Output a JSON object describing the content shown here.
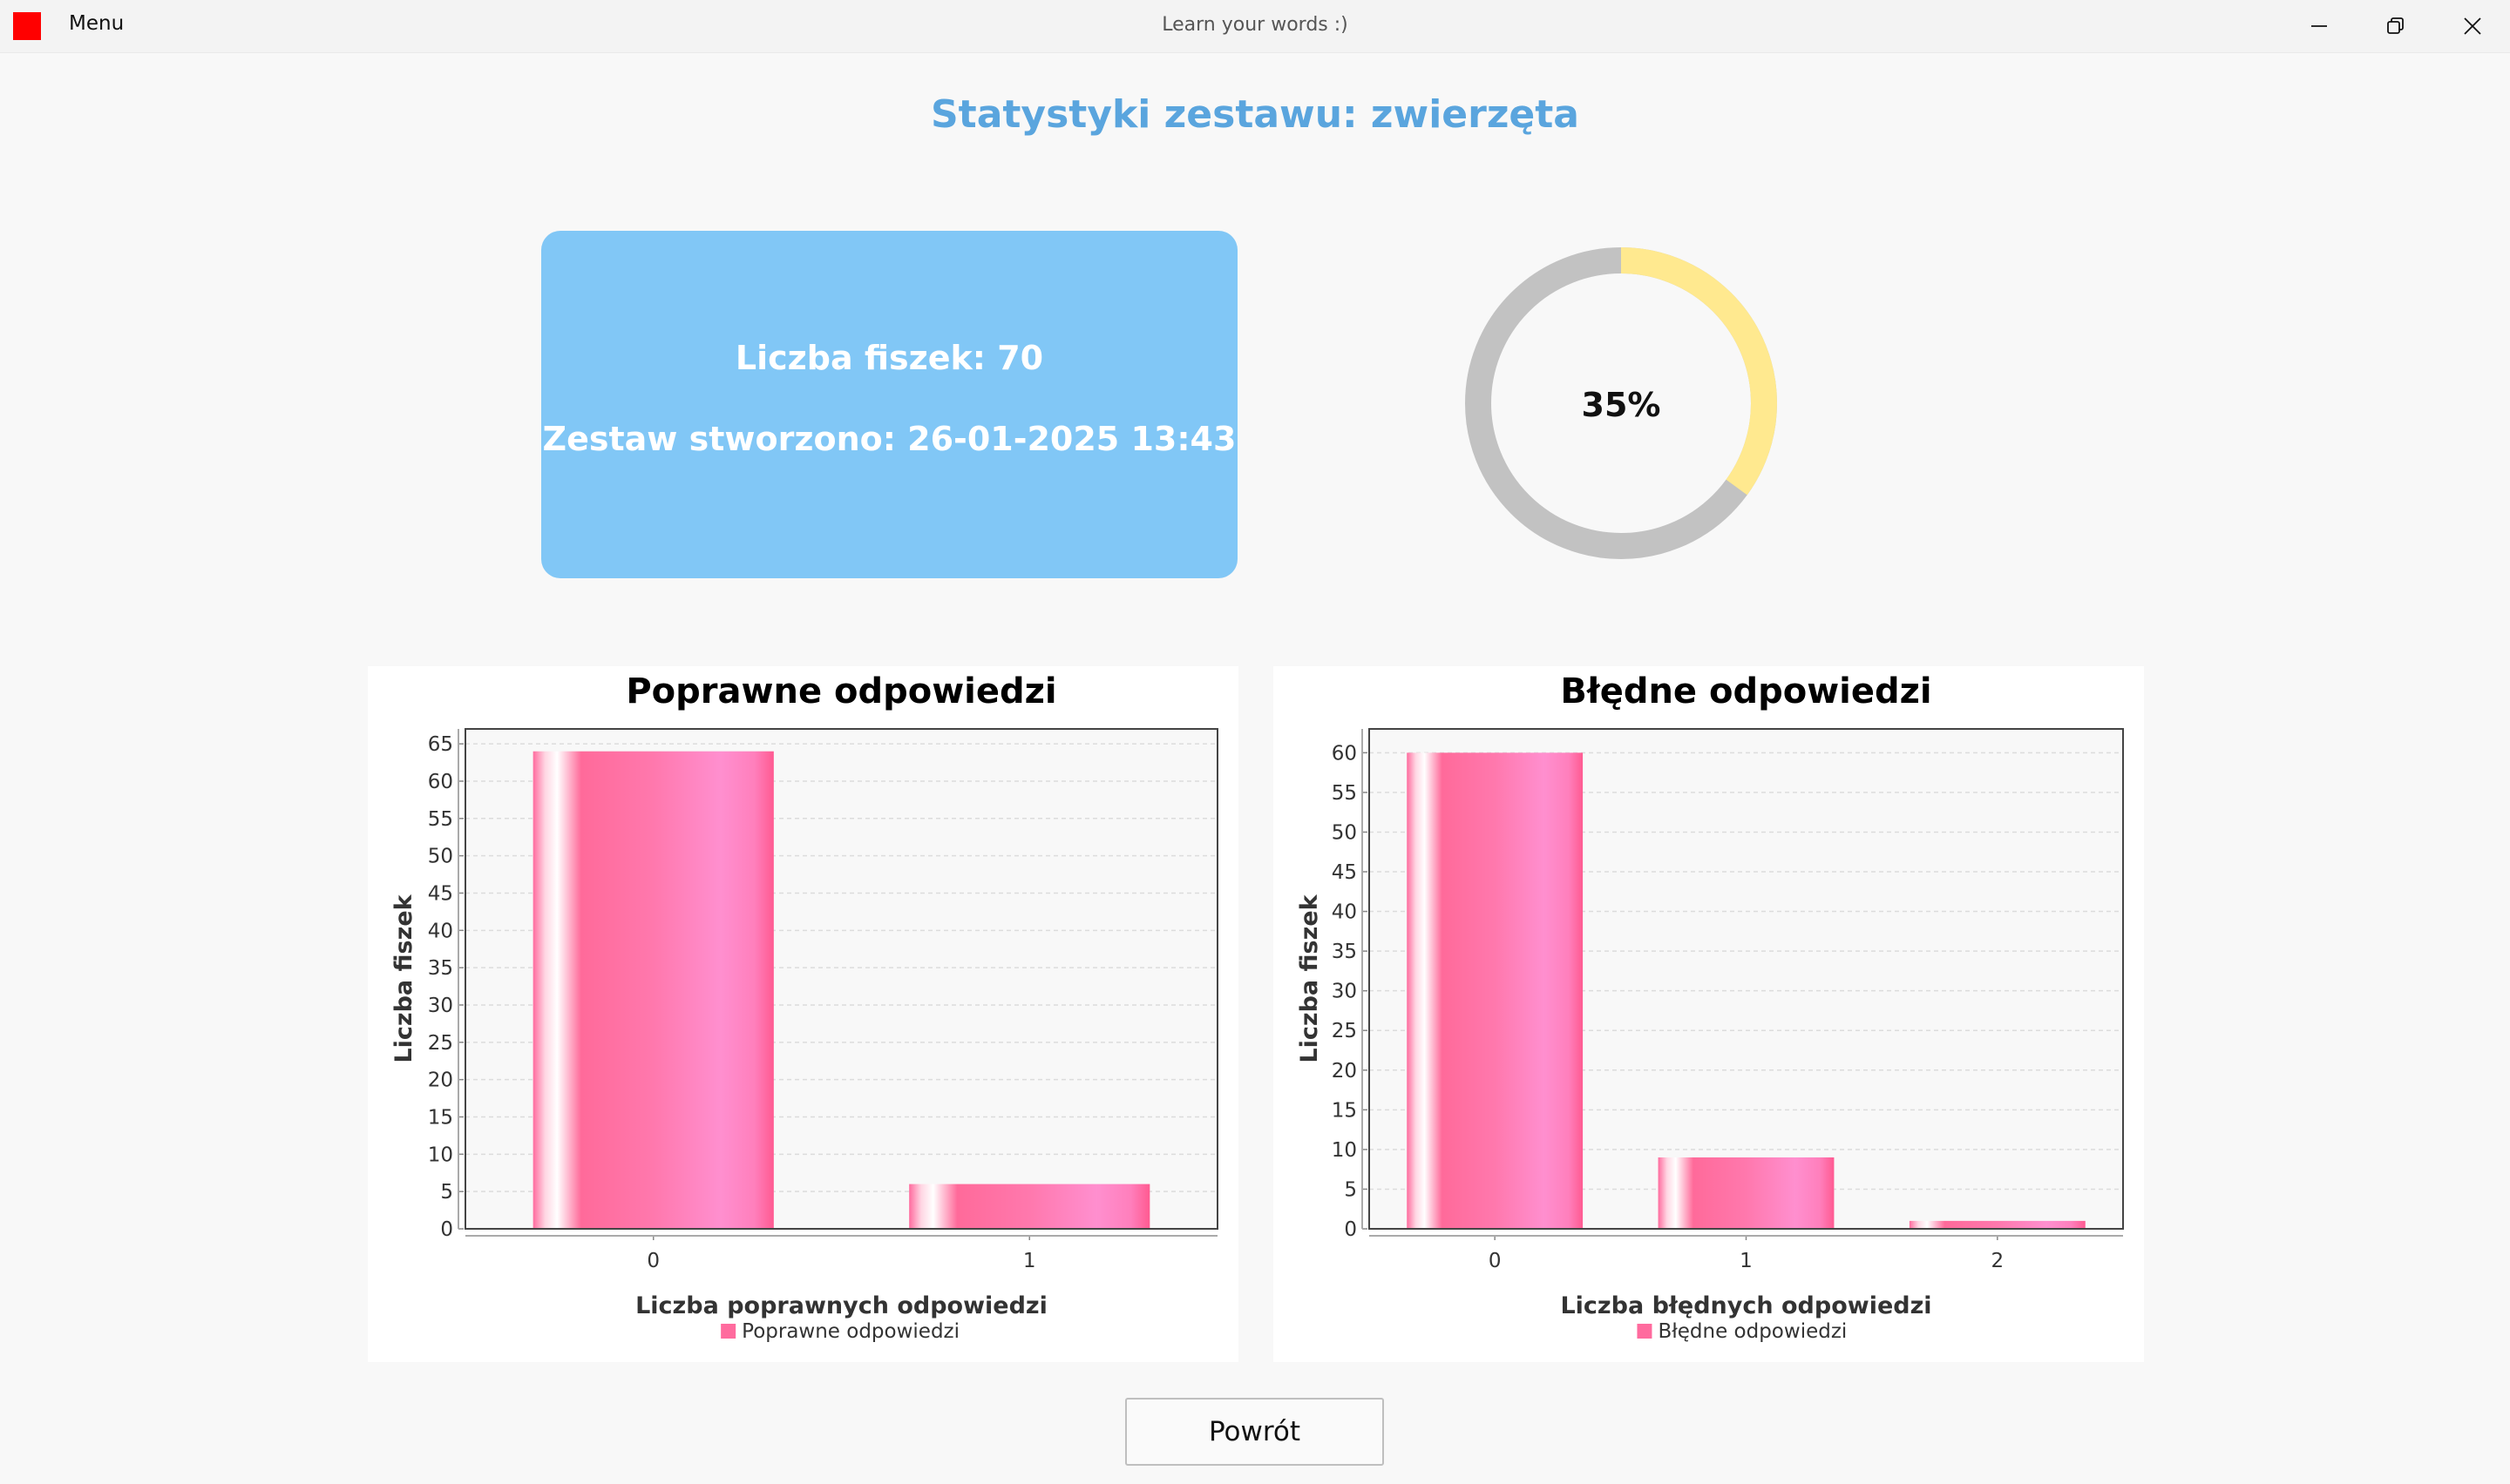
{
  "window": {
    "menu_label": "Menu",
    "title": "Learn your words :)",
    "icons": [
      "app-icon",
      "minimize-icon",
      "restore-icon",
      "close-icon"
    ]
  },
  "page": {
    "title": "Statystyki zestawu: zwierzęta"
  },
  "info": {
    "card_count": "Liczba fiszek: 70",
    "created": "Zestaw stworzono: 26-01-2025 13:43"
  },
  "progress": {
    "label": "35%",
    "value": 0.35,
    "fill_color": "#ffe98f",
    "track_color": "#c2c2c2"
  },
  "chart_data": [
    {
      "type": "bar",
      "title": "Poprawne odpowiedzi",
      "xlabel": "Liczba poprawnych odpowiedzi",
      "ylabel": "Liczba fiszek",
      "categories": [
        "0",
        "1"
      ],
      "series": [
        {
          "name": "Poprawne odpowiedzi",
          "values": [
            64,
            6
          ]
        }
      ],
      "ylim": [
        0,
        67
      ],
      "yticks": [
        0,
        5,
        10,
        15,
        20,
        25,
        30,
        35,
        40,
        45,
        50,
        55,
        60,
        65
      ],
      "grid": true,
      "legend": "bottom",
      "color": "#ff6b9e"
    },
    {
      "type": "bar",
      "title": "Błędne odpowiedzi",
      "xlabel": "Liczba błędnych odpowiedzi",
      "ylabel": "Liczba fiszek",
      "categories": [
        "0",
        "1",
        "2"
      ],
      "series": [
        {
          "name": "Błędne odpowiedzi",
          "values": [
            60,
            9,
            1
          ]
        }
      ],
      "ylim": [
        0,
        63
      ],
      "yticks": [
        0,
        5,
        10,
        15,
        20,
        25,
        30,
        35,
        40,
        45,
        50,
        55,
        60
      ],
      "grid": true,
      "legend": "bottom",
      "color": "#ff6b9e"
    }
  ],
  "actions": {
    "back_label": "Powrót"
  }
}
